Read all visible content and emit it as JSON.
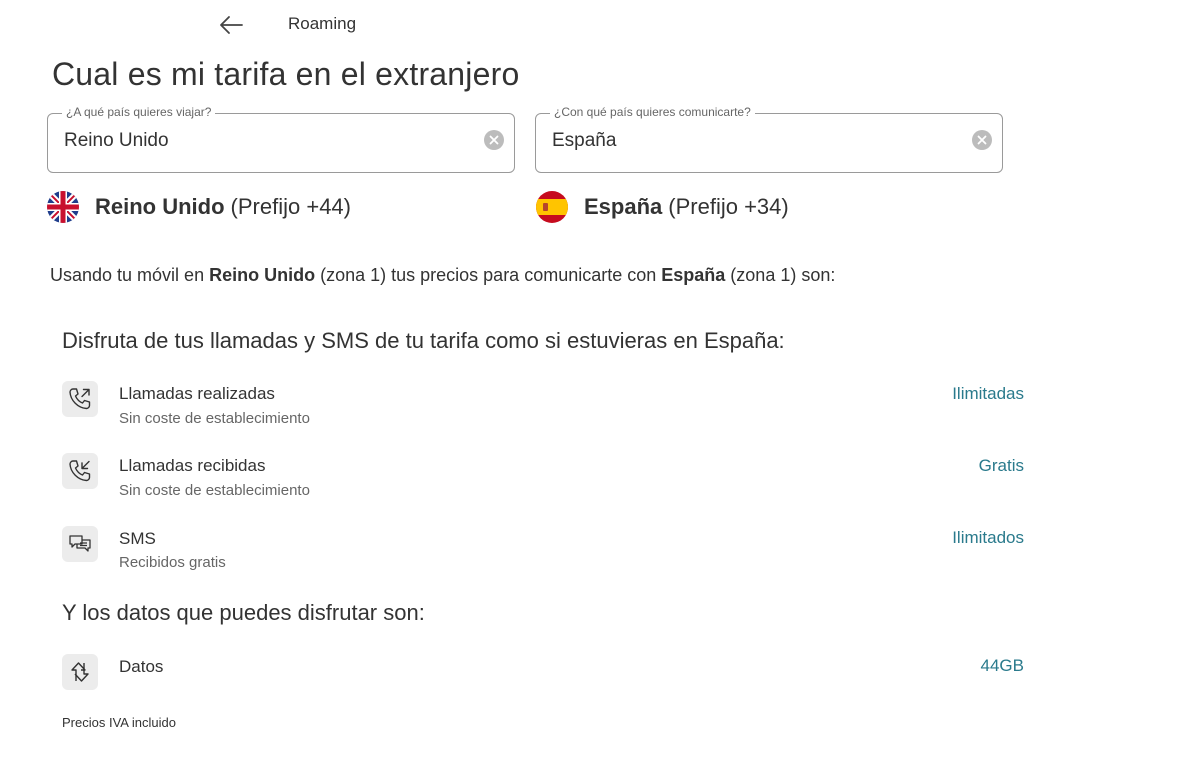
{
  "header": {
    "title": "Roaming"
  },
  "page": {
    "title": "Cual es mi tarifa en el extranjero"
  },
  "search": {
    "travel": {
      "label": "¿A qué país quieres viajar?",
      "value": "Reino Unido"
    },
    "communicate": {
      "label": "¿Con qué país quieres comunicarte?",
      "value": "España"
    }
  },
  "countries": {
    "travel": {
      "name": "Reino Unido",
      "prefix": "(Prefijo +44)",
      "flag_icon": "uk-flag-icon"
    },
    "communicate": {
      "name": "España",
      "prefix": "(Prefijo +34)",
      "flag_icon": "spain-flag-icon"
    }
  },
  "summary": {
    "pre": "Usando tu móvil en ",
    "travel_country": "Reino Unido",
    "mid": " (zona 1) tus precios para comunicarte con ",
    "communicate_country": "España",
    "post": " (zona 1) son:"
  },
  "calls_section": {
    "heading": "Disfruta de tus llamadas y SMS de tu tarifa como si estuvieras en España:",
    "items": [
      {
        "icon": "outgoing-call-icon",
        "title": "Llamadas realizadas",
        "subtitle": "Sin coste de establecimiento",
        "value": "Ilimitadas"
      },
      {
        "icon": "incoming-call-icon",
        "title": "Llamadas recibidas",
        "subtitle": "Sin coste de establecimiento",
        "value": "Gratis"
      },
      {
        "icon": "sms-icon",
        "title": "SMS",
        "subtitle": "Recibidos gratis",
        "value": "Ilimitados"
      }
    ]
  },
  "data_section": {
    "heading": "Y los datos que puedes disfrutar son:",
    "items": [
      {
        "icon": "data-transfer-icon",
        "title": "Datos",
        "value": "44GB"
      }
    ]
  },
  "footnote": "Precios IVA incluido",
  "colors": {
    "accent": "#2a7a8c",
    "text": "#333333",
    "muted": "#666666",
    "icon_bg": "#ececec"
  }
}
